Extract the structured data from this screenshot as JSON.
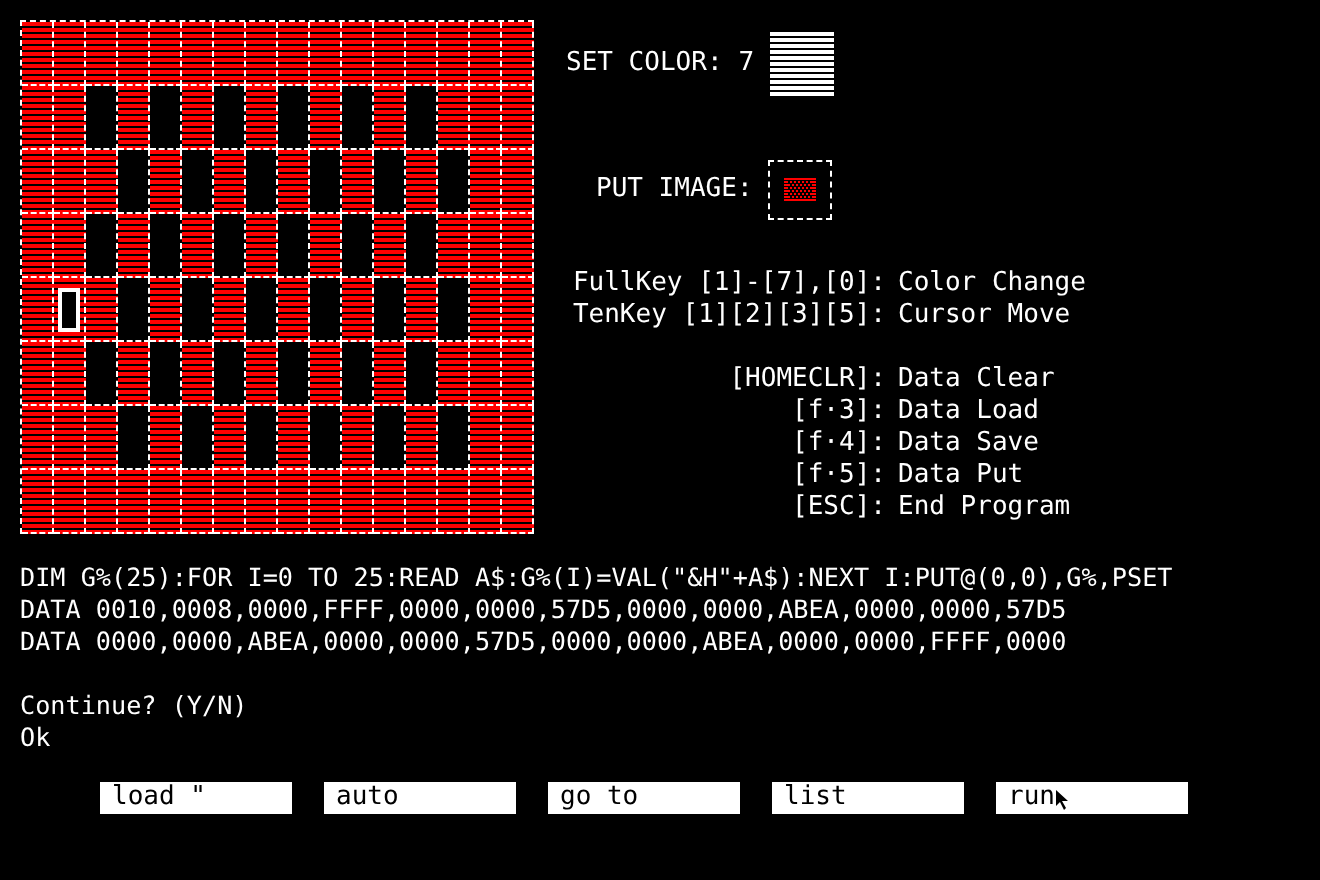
{
  "editor": {
    "rows": [
      {
        "cells": [
          true,
          true,
          true,
          true,
          true,
          true,
          true,
          true,
          true,
          true,
          true,
          true,
          true,
          true,
          true,
          true
        ],
        "cursor": [
          false,
          false,
          false,
          false,
          false,
          false,
          false,
          false,
          false,
          false,
          false,
          false,
          false,
          false,
          false,
          false
        ]
      },
      {
        "cells": [
          true,
          true,
          false,
          true,
          false,
          true,
          false,
          true,
          false,
          true,
          false,
          true,
          false,
          true,
          true,
          true
        ],
        "cursor": [
          false,
          false,
          false,
          false,
          false,
          false,
          false,
          false,
          false,
          false,
          false,
          false,
          false,
          false,
          false,
          false
        ]
      },
      {
        "cells": [
          true,
          true,
          true,
          false,
          true,
          false,
          true,
          false,
          true,
          false,
          true,
          false,
          true,
          false,
          true,
          true
        ],
        "cursor": [
          false,
          false,
          false,
          false,
          false,
          false,
          false,
          false,
          false,
          false,
          false,
          false,
          false,
          false,
          false,
          false
        ]
      },
      {
        "cells": [
          true,
          true,
          false,
          true,
          false,
          true,
          false,
          true,
          false,
          true,
          false,
          true,
          false,
          true,
          true,
          true
        ],
        "cursor": [
          false,
          false,
          false,
          false,
          false,
          false,
          false,
          false,
          false,
          false,
          false,
          false,
          false,
          false,
          false,
          false
        ]
      },
      {
        "cells": [
          true,
          true,
          true,
          false,
          true,
          false,
          true,
          false,
          true,
          false,
          true,
          false,
          true,
          false,
          true,
          true
        ],
        "cursor": [
          false,
          true,
          false,
          false,
          false,
          false,
          false,
          false,
          false,
          false,
          false,
          false,
          false,
          false,
          false,
          false
        ]
      },
      {
        "cells": [
          true,
          true,
          false,
          true,
          false,
          true,
          false,
          true,
          false,
          true,
          false,
          true,
          false,
          true,
          true,
          true
        ],
        "cursor": [
          false,
          false,
          false,
          false,
          false,
          false,
          false,
          false,
          false,
          false,
          false,
          false,
          false,
          false,
          false,
          false
        ]
      },
      {
        "cells": [
          true,
          true,
          true,
          false,
          true,
          false,
          true,
          false,
          true,
          false,
          true,
          false,
          true,
          false,
          true,
          true
        ],
        "cursor": [
          false,
          false,
          false,
          false,
          false,
          false,
          false,
          false,
          false,
          false,
          false,
          false,
          false,
          false,
          false,
          false
        ]
      },
      {
        "cells": [
          true,
          true,
          true,
          true,
          true,
          true,
          true,
          true,
          true,
          true,
          true,
          true,
          true,
          true,
          true,
          true
        ],
        "cursor": [
          false,
          false,
          false,
          false,
          false,
          false,
          false,
          false,
          false,
          false,
          false,
          false,
          false,
          false,
          false,
          false
        ]
      }
    ],
    "color": "#ff0000"
  },
  "set_color": {
    "label": "SET COLOR:",
    "value": "7",
    "color": "#ffffff"
  },
  "put_image": {
    "label": "PUT IMAGE:"
  },
  "help_groups": [
    {
      "items": [
        {
          "key": "FullKey [1]-[7],[0]:",
          "action": "Color Change"
        },
        {
          "key": "TenKey [1][2][3][5]:",
          "action": "Cursor Move"
        }
      ]
    },
    {
      "items": [
        {
          "key": "[HOMECLR]:",
          "action": "Data Clear"
        },
        {
          "key": "[f·3]:",
          "action": "Data Load"
        },
        {
          "key": "[f·4]:",
          "action": "Data Save"
        },
        {
          "key": "[f·5]:",
          "action": "Data Put"
        },
        {
          "key": "[ESC]:",
          "action": "End Program"
        }
      ]
    }
  ],
  "console": [
    {
      "lines": [
        "DIM G%(25):FOR I=0 TO 25:READ A$:G%(I)=VAL(\"&H\"+A$):NEXT I:PUT@(0,0),G%,PSET",
        "DATA 0010,0008,0000,FFFF,0000,0000,57D5,0000,0000,ABEA,0000,0000,57D5",
        "DATA 0000,0000,ABEA,0000,0000,57D5,0000,0000,ABEA,0000,0000,FFFF,0000"
      ]
    },
    {
      "lines": [
        "Continue? (Y/N)",
        "Ok"
      ]
    }
  ],
  "function_keys": [
    {
      "label": "load \"",
      "pointer": false
    },
    {
      "label": "auto",
      "pointer": false
    },
    {
      "label": "go to",
      "pointer": false
    },
    {
      "label": "list",
      "pointer": false
    },
    {
      "label": "run",
      "pointer": true
    }
  ]
}
